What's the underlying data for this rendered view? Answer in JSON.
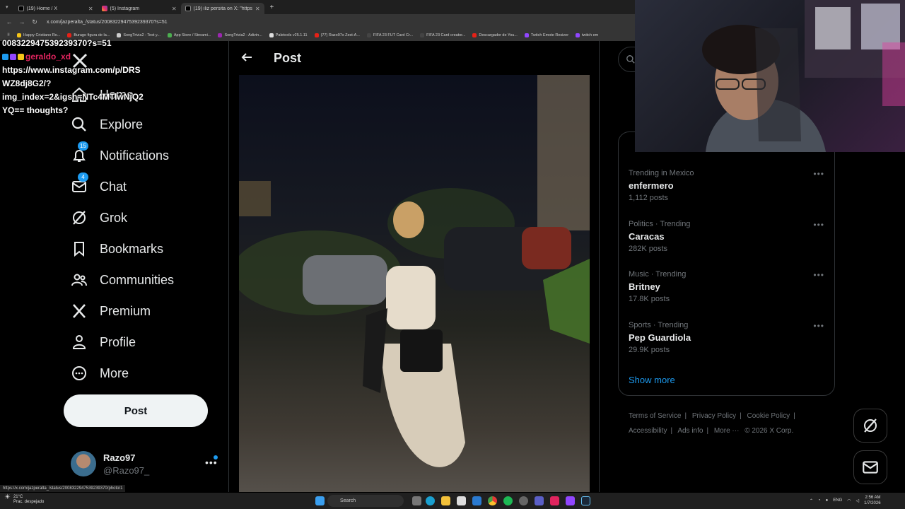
{
  "browser": {
    "tabs": [
      {
        "title": "(19) Home / X",
        "color": "#ffffff",
        "active": false
      },
      {
        "title": "(5) Instagram",
        "color": "#e1306c",
        "active": false
      },
      {
        "title": "(19) iliz persita on X: \"https://...",
        "color": "#ffffff",
        "active": true
      }
    ],
    "url": "x.com/jazperalta_/status/2008322947539239370?s=51",
    "bookmarks": [
      "Happy Cristiano Ro...",
      "Burago figura de la...",
      "SongTrivia2 - Test y...",
      "App Store / Streami...",
      "SongTrivia2 - Adivin...",
      "Paletools v25.1.11",
      "(77) Razo97s Zest-A...",
      "FIFA 23 FUT Card Cr...",
      "FIFA 23 Card creator...",
      "Descargador de You...",
      "Twitch Emote Resizer",
      "twitch em"
    ]
  },
  "overlay": {
    "line1": "008322947539239370?s=51",
    "username": "geraldo_xd",
    "message_lines": [
      "https://www.instagram.com/p/DRS",
      "WZ8dj8G2/?",
      "img_index=2&igsh=NTc4MTlwNjQ2",
      "YQ== thoughts?"
    ]
  },
  "nav": {
    "items": [
      {
        "label": "Home",
        "icon": "home-icon",
        "badge": ""
      },
      {
        "label": "Explore",
        "icon": "search-icon",
        "badge": ""
      },
      {
        "label": "Notifications",
        "icon": "bell-icon",
        "badge": "15"
      },
      {
        "label": "Chat",
        "icon": "mail-icon",
        "badge": "4"
      },
      {
        "label": "Grok",
        "icon": "grok-icon",
        "badge": ""
      },
      {
        "label": "Bookmarks",
        "icon": "bookmark-icon",
        "badge": ""
      },
      {
        "label": "Communities",
        "icon": "people-icon",
        "badge": ""
      },
      {
        "label": "Premium",
        "icon": "x-logo-icon",
        "badge": ""
      },
      {
        "label": "Profile",
        "icon": "person-icon",
        "badge": ""
      },
      {
        "label": "More",
        "icon": "more-circle-icon",
        "badge": ""
      }
    ],
    "post_button": "Post",
    "account": {
      "name": "Razo97",
      "handle": "@Razo97_",
      "more": "•••"
    }
  },
  "center": {
    "title": "Post"
  },
  "trending": {
    "items": [
      {
        "context": "Trending in Mexico",
        "name": "enfermero",
        "count": "1,112 posts"
      },
      {
        "context": "Politics · Trending",
        "name": "Caracas",
        "count": "282K posts"
      },
      {
        "context": "Music · Trending",
        "name": "Britney",
        "count": "17.8K posts"
      },
      {
        "context": "Sports · Trending",
        "name": "Pep Guardiola",
        "count": "29.9K posts"
      }
    ],
    "show_more": "Show more",
    "more_dots": "•••"
  },
  "footer": {
    "links": [
      "Terms of Service",
      "|",
      "Privacy Policy",
      "|",
      "Cookie Policy",
      "|",
      "Accessibility",
      "|",
      "Ads info",
      "|",
      "More ···",
      "© 2026 X Corp."
    ]
  },
  "statusbar": {
    "url": "https://x.com/jazperalta_/status/2008322947539239370/photo/1"
  },
  "taskbar": {
    "weather_temp": "21°C",
    "weather_desc": "Prac. despejado",
    "search": "Search",
    "lang": "ENG",
    "time": "2:56 AM",
    "date": "1/7/2026"
  },
  "colors": {
    "accent": "#1d9bf0",
    "background": "#000000",
    "text": "#e7e9ea",
    "muted": "#71767b",
    "border": "#2f3336"
  }
}
